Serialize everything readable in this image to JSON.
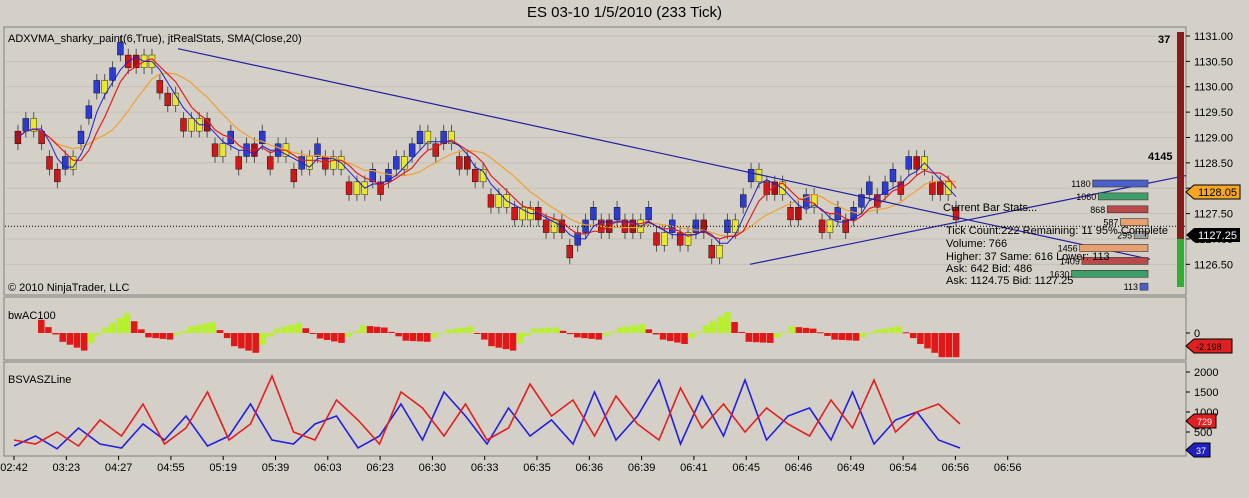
{
  "window": {
    "title": "ES 03-10  1/5/2010 (233 Tick)"
  },
  "price_panel": {
    "indicator_label": "ADXVMA_sharky_paint(6,True), jtRealStats, SMA(Close,20)",
    "copyright": "© 2010 NinjaTrader, LLC",
    "marker_37": "37",
    "label_4145": "4145",
    "last_price": "1128.05",
    "current_price": "1127.25",
    "stats": {
      "title": "Current Bar Stats...",
      "tick_line": "Tick Count:222  Remaining: 11  95% Complete",
      "volume_line": "Volume: 766",
      "hsl_line": "Higher: 37   Same: 616   Lower: 113",
      "askbid_line": "Ask:   642       Bid:   486",
      "askbid_px_line": "Ask: 1124.75  Bid: 1127.25"
    },
    "volume_profile": [
      {
        "label": "1180",
        "value": 1180,
        "color": "#4a5fc8"
      },
      {
        "label": "1060",
        "value": 1060,
        "color": "#3f9f6a"
      },
      {
        "label": "868",
        "value": 868,
        "color": "#b84a4a"
      },
      {
        "label": "587",
        "value": 587,
        "color": "#e8a070"
      },
      {
        "label": "295",
        "value": 295,
        "color": "#a0a0a0"
      },
      {
        "label": "1456",
        "value": 1456,
        "color": "#e8a070"
      },
      {
        "label": "1409",
        "value": 1409,
        "color": "#b84a4a"
      },
      {
        "label": "1630",
        "value": 1630,
        "color": "#3f9f6a"
      },
      {
        "label": "113",
        "value": 113,
        "color": "#4a5fc8"
      }
    ]
  },
  "ac_panel": {
    "label": "bwAC100",
    "value_badge": "-2.198"
  },
  "vasz_panel": {
    "label": "BSVASZLine",
    "badge_red": "729",
    "badge_blue": "37"
  },
  "chart_data": [
    {
      "type": "candlestick",
      "title": "ES 03-10  1/5/2010 (233 Tick)",
      "ylim": [
        1126.25,
        1131.0
      ],
      "yticks": [
        "1131.00",
        "1130.50",
        "1130.00",
        "1129.50",
        "1129.00",
        "1128.50",
        "1128.00",
        "1127.50",
        "1127.00",
        "1126.50"
      ],
      "xticks": [
        "02:42",
        "03:23",
        "04:27",
        "04:55",
        "05:19",
        "05:39",
        "06:03",
        "06:23",
        "06:30",
        "06:33",
        "06:35",
        "06:36",
        "06:39",
        "06:41",
        "06:45",
        "06:46",
        "06:49",
        "06:54",
        "06:56",
        "06:56"
      ],
      "price_points": [
        [
          0,
          1129.25
        ],
        [
          4,
          1129.25
        ],
        [
          10,
          1128.25
        ],
        [
          14,
          1128.75
        ],
        [
          22,
          1130.25
        ],
        [
          28,
          1130.75
        ],
        [
          34,
          1130.25
        ],
        [
          40,
          1129.5
        ],
        [
          46,
          1129.0
        ],
        [
          54,
          1128.75
        ],
        [
          62,
          1128.75
        ],
        [
          70,
          1128.5
        ],
        [
          78,
          1128.5
        ],
        [
          86,
          1128.0
        ],
        [
          92,
          1128.25
        ],
        [
          98,
          1128.75
        ],
        [
          104,
          1129.0
        ],
        [
          108,
          1128.75
        ],
        [
          114,
          1128.25
        ],
        [
          120,
          1127.75
        ],
        [
          126,
          1127.5
        ],
        [
          132,
          1127.25
        ],
        [
          138,
          1127.0
        ],
        [
          144,
          1127.25
        ],
        [
          150,
          1127.5
        ],
        [
          156,
          1127.25
        ],
        [
          162,
          1127.0
        ],
        [
          168,
          1127.25
        ],
        [
          174,
          1126.75
        ],
        [
          178,
          1127.5
        ],
        [
          182,
          1128.25
        ],
        [
          186,
          1128.0
        ],
        [
          192,
          1127.75
        ],
        [
          198,
          1127.5
        ],
        [
          204,
          1127.25
        ],
        [
          210,
          1127.75
        ],
        [
          216,
          1128.0
        ],
        [
          222,
          1128.5
        ],
        [
          228,
          1128.0
        ],
        [
          233,
          1127.75
        ]
      ],
      "last": 1127.25,
      "series": [
        {
          "name": "SMA(Close,20)",
          "color": "#f0a030"
        },
        {
          "name": "ADXVMA",
          "color": "#e02020"
        }
      ]
    },
    {
      "type": "bar",
      "title": "bwAC100",
      "ylim": [
        -2.5,
        2.5
      ],
      "yticks": [
        "0"
      ],
      "value_series": [
        1.2,
        -0.8,
        -1.6,
        0.5,
        1.8,
        -0.4,
        -0.6,
        0.6,
        1.0,
        -1.2,
        -1.8,
        0.4,
        0.9,
        -0.5,
        -0.9,
        0.7,
        0.5,
        -0.7,
        -0.8,
        0.3,
        0.6,
        -1.2,
        -1.6,
        0.4,
        0.5,
        -0.4,
        -0.6,
        0.5,
        0.8,
        -0.6,
        -1.0,
        0.7,
        1.9,
        -0.8,
        -0.9,
        0.6,
        0.4,
        -0.6,
        -0.7,
        0.3,
        0.6,
        -1.0,
        -2.2
      ]
    },
    {
      "type": "line",
      "title": "BSVASZLine",
      "ylim": [
        0,
        2100
      ],
      "yticks": [
        "2000",
        "1500",
        "1000",
        "500"
      ],
      "series": [
        {
          "name": "blue",
          "color": "#2020e0",
          "values": [
            150,
            400,
            80,
            600,
            200,
            100,
            700,
            300,
            900,
            150,
            400,
            1200,
            300,
            200,
            700,
            900,
            100,
            400,
            1200,
            300,
            1500,
            900,
            200,
            1100,
            400,
            800,
            200,
            1500,
            300,
            900,
            1800,
            200,
            1400,
            400,
            1800,
            300,
            900,
            1100,
            300,
            1500,
            200,
            800,
            1000,
            300,
            100
          ]
        },
        {
          "name": "red",
          "color": "#e02020",
          "values": [
            300,
            200,
            500,
            150,
            800,
            400,
            1200,
            200,
            600,
            1500,
            300,
            700,
            1900,
            500,
            300,
            1300,
            800,
            200,
            1500,
            1100,
            400,
            1200,
            300,
            600,
            1700,
            900,
            1300,
            400,
            1400,
            700,
            300,
            1600,
            600,
            1200,
            500,
            1100,
            700,
            400,
            1300,
            600,
            1800,
            500,
            1000,
            1200,
            700
          ]
        }
      ]
    }
  ]
}
